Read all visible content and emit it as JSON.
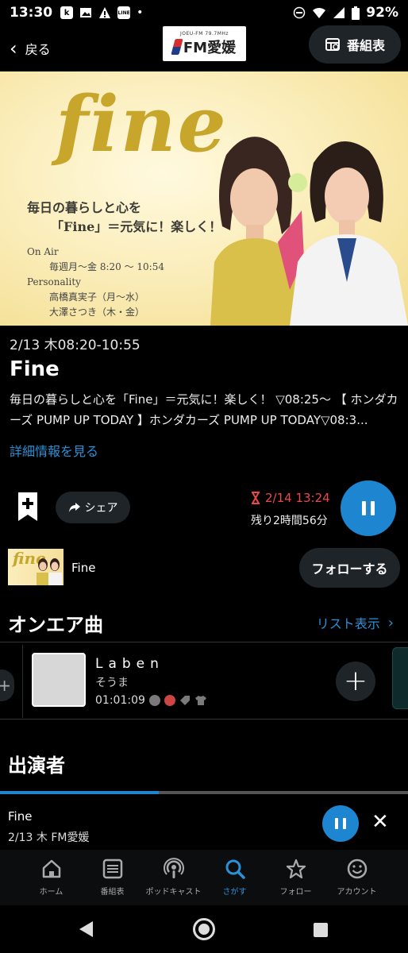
{
  "status_bar": {
    "time": "13:30",
    "left_icons": [
      "k-app-icon",
      "image-icon",
      "warning-icon",
      "line-icon",
      "dot-icon"
    ],
    "battery_percent": "92%"
  },
  "header": {
    "back_label": "戻る",
    "logo_small": "JOEU-FM 79.7MHz",
    "logo_text": "FM愛媛",
    "schedule_button_label": "番組表"
  },
  "hero": {
    "title": "fine",
    "tagline_1": "毎日の暮らしと心を",
    "tagline_2": "「Fine」＝元気に！楽しく！",
    "on_air_label": "On Air",
    "on_air_time": "毎週月～金 8:20 ～ 10:54",
    "personality_label": "Personality",
    "personality_1": "高橋真実子（月～水）",
    "personality_2": "大澤さつき（木・金）"
  },
  "program": {
    "date_time": "2/13 木08:20-10:55",
    "title": "Fine",
    "description": " 毎日の暮らしと心を「Fine」＝元気に！楽しく！ ▽08:25～ 【 ホンダカーズ PUMP UP TODAY 】ホンダカーズ PUMP UP TODAY▽08:3...",
    "more_link": "詳細情報を見る"
  },
  "actions": {
    "share_label": "シェア",
    "timer_deadline": "2/14 13:24",
    "remaining": "残り2時間56分"
  },
  "follow": {
    "thumb_text": "fine",
    "program_name": "Fine",
    "follow_label": "フォローする"
  },
  "onair": {
    "section_title": "オンエア曲",
    "list_link": "リスト表示",
    "track": {
      "name": "Laben",
      "artist": "そうま",
      "time": "01:01:09"
    }
  },
  "cast": {
    "section_title": "出演者"
  },
  "mini_player": {
    "title": "Fine",
    "subtitle": "2/13 木 FM愛媛",
    "progress": 0.39
  },
  "bottom_nav": [
    {
      "label": "ホーム",
      "icon": "home-icon"
    },
    {
      "label": "番組表",
      "icon": "list-icon"
    },
    {
      "label": "ポッドキャスト",
      "icon": "podcast-icon"
    },
    {
      "label": "さがす",
      "icon": "search-icon",
      "active": true
    },
    {
      "label": "フォロー",
      "icon": "star-icon"
    },
    {
      "label": "アカウント",
      "icon": "smile-icon"
    }
  ],
  "colors": {
    "accent": "#1e86d0",
    "link": "#2a91d8",
    "timer_red": "#e84a4a",
    "pill_bg": "#1f2428"
  }
}
